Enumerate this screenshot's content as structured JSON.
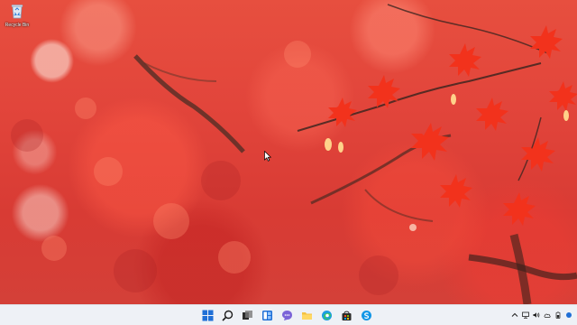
{
  "desktop": {
    "wallpaper": "red-maple-leaves",
    "icons": [
      {
        "label": "Recycle Bin",
        "icon": "recycle-bin-icon"
      }
    ]
  },
  "taskbar": {
    "background": "#eef1f6",
    "accent": "#1f6fd6",
    "pinned": [
      {
        "name": "start-button",
        "icon": "windows-logo-icon"
      },
      {
        "name": "search-button",
        "icon": "search-icon"
      },
      {
        "name": "task-view-button",
        "icon": "task-view-icon"
      },
      {
        "name": "widgets-button",
        "icon": "widgets-icon"
      },
      {
        "name": "chat-button",
        "icon": "chat-icon"
      },
      {
        "name": "file-explorer-button",
        "icon": "folder-icon"
      },
      {
        "name": "edge-button",
        "icon": "edge-icon"
      },
      {
        "name": "store-button",
        "icon": "store-icon"
      },
      {
        "name": "skype-button",
        "icon": "skype-icon"
      }
    ],
    "tray": [
      {
        "name": "show-hidden-icons",
        "icon": "chevron-up-icon"
      },
      {
        "name": "network-status",
        "icon": "network-icon"
      },
      {
        "name": "volume-status",
        "icon": "speaker-icon"
      },
      {
        "name": "onedrive-status",
        "icon": "cloud-icon"
      },
      {
        "name": "battery-status",
        "icon": "battery-icon"
      },
      {
        "name": "notifications",
        "icon": "notification-icon"
      }
    ]
  }
}
